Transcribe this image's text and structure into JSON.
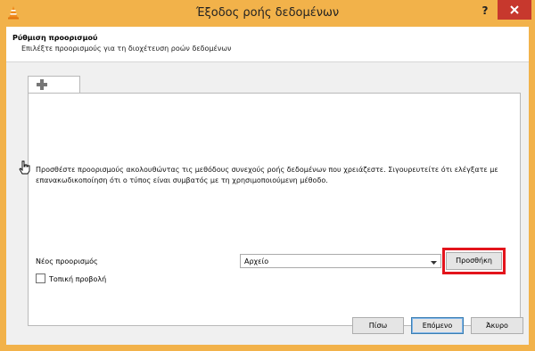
{
  "window": {
    "title": "Έξοδος ροής δεδομένων",
    "help": "?",
    "app_icon": "vlc-cone-icon",
    "close_icon": "close-icon"
  },
  "header": {
    "title": "Ρύθμιση προορισμού",
    "subtitle": "Επιλέξτε προορισμούς για τη διοχέτευση ροών δεδομένων"
  },
  "tab": {
    "icon": "plus-icon"
  },
  "panel": {
    "info_text": "Προσθέστε προορισμούς ακολουθώντας τις μεθόδους συνεχούς ροής δεδομένων που χρειάζεστε. Σιγουρευτείτε ότι ελέγξατε με επανακωδικοποίηση ότι ο τύπος είναι συμβατός με τη χρησιμοποιούμενη μέθοδο.",
    "new_destination_label": "Νέος προορισμός",
    "destination_value": "Αρχείο",
    "add_button": "Προσθήκη",
    "local_playback_label": "Τοπική προβολή",
    "local_playback_checked": false
  },
  "buttons": {
    "back": "Πίσω",
    "next": "Επόμενο",
    "cancel": "Άκυρο"
  },
  "colors": {
    "title_bar": "#f2b24a",
    "close_button": "#c7382d",
    "highlight": "#e3141c"
  }
}
